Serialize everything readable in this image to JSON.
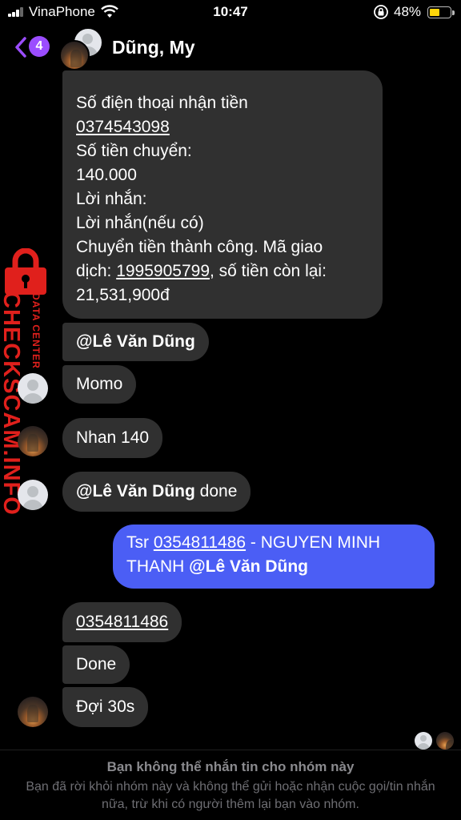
{
  "status_bar": {
    "carrier": "VinaPhone",
    "time": "10:47",
    "battery_percent": "48%",
    "battery_level": 0.48,
    "accent_color": "#ffd60a"
  },
  "header": {
    "back_badge": "4",
    "title": "Dũng, My",
    "badge_color": "#9b4dff"
  },
  "messages": [
    {
      "lines": [
        "Số điện thoại nhận tiền",
        "0374543098",
        "Số tiền chuyển:",
        "140.000",
        "Lời nhắn:",
        "Lời nhắn(nếu có)",
        "Chuyển tiền thành công. Mã giao",
        "dịch: ",
        "1995905799",
        ", số tiền còn lại:",
        "21,531,900đ"
      ]
    },
    {
      "mention": "@Lê Văn Dũng",
      "text": ""
    },
    {
      "text": "Momo"
    },
    {
      "text": "Nhan 140"
    },
    {
      "mention": "@Lê Văn Dũng",
      "text": " done"
    },
    {
      "prefix": "Tsr ",
      "phone": "0354811486",
      "rest": " - NGUYEN MINH THANH ",
      "mention": "@Lê Văn Dũng",
      "color": "#4b5ef5"
    },
    {
      "text": "0354811486"
    },
    {
      "text": "Done"
    },
    {
      "text": "Đợi 30s"
    }
  ],
  "watermark": {
    "text": "CHECKSCAM.INFO",
    "subtext": "DATA CENTER",
    "color": "#e0201c"
  },
  "footer": {
    "title": "Bạn không thể nhắn tin cho nhóm này",
    "text": "Bạn đã rời khỏi nhóm này và không thể gửi hoặc nhận cuộc gọi/tin nhắn nữa, trừ khi có người thêm lại bạn vào nhóm."
  },
  "icons": [
    "signal-icon",
    "wifi-icon",
    "rotation-lock-icon",
    "battery-icon",
    "back-chevron-icon",
    "default-avatar-icon",
    "padlock-icon"
  ]
}
